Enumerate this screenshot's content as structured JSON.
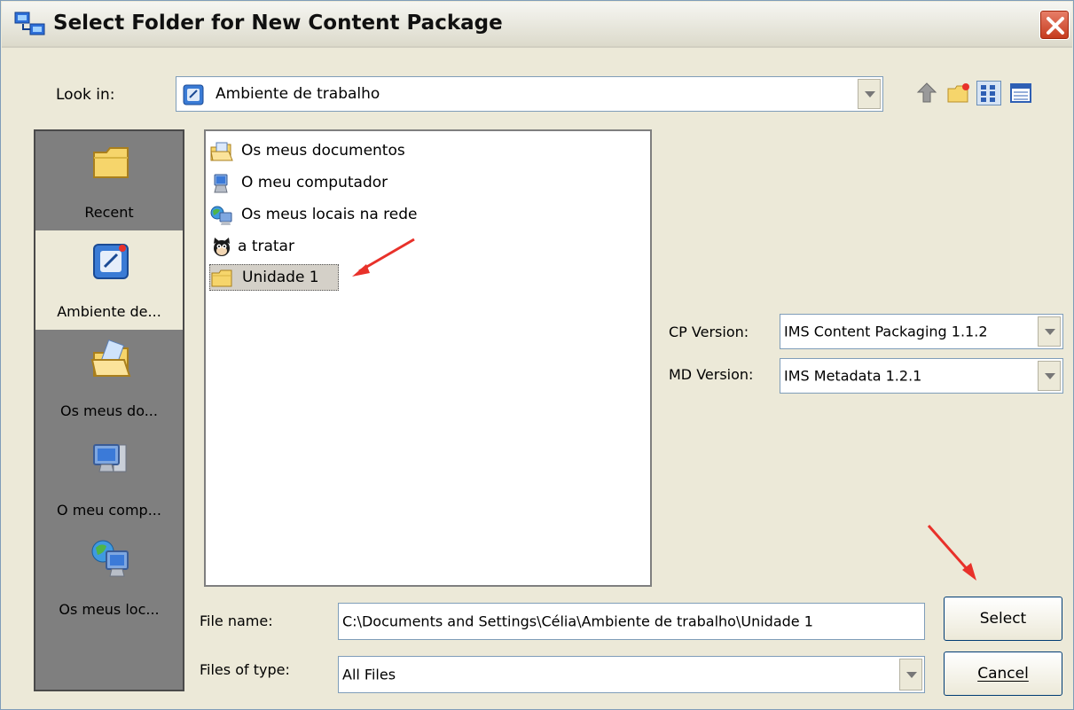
{
  "window": {
    "title": "Select Folder for New Content Package"
  },
  "look_in": {
    "label": "Look in:",
    "value": "Ambiente de trabalho"
  },
  "toolbar": {
    "icons": [
      "up-one-level-icon",
      "new-folder-icon",
      "list-view-icon",
      "details-view-icon"
    ]
  },
  "places": [
    {
      "label": "Recent",
      "icon": "recent-folder-icon"
    },
    {
      "label": "Ambiente de...",
      "icon": "desktop-icon",
      "selected": true
    },
    {
      "label": "Os meus do...",
      "icon": "my-documents-icon"
    },
    {
      "label": "O meu comp...",
      "icon": "my-computer-icon"
    },
    {
      "label": "Os meus loc...",
      "icon": "network-places-icon"
    }
  ],
  "files": [
    {
      "label": "Os meus documentos",
      "icon": "my-documents-icon"
    },
    {
      "label": "O meu computador",
      "icon": "my-computer-icon"
    },
    {
      "label": "Os meus locais na rede",
      "icon": "network-places-icon"
    },
    {
      "label": "a tratar",
      "icon": "cat-icon"
    },
    {
      "label": "Unidade 1",
      "icon": "folder-icon",
      "selected": true
    }
  ],
  "cp_version": {
    "label": "CP Version:",
    "value": "IMS Content Packaging 1.1.2"
  },
  "md_version": {
    "label": "MD Version:",
    "value": "IMS Metadata 1.2.1"
  },
  "file_name": {
    "label": "File name:",
    "value": "C:\\Documents and Settings\\Célia\\Ambiente de trabalho\\Unidade 1"
  },
  "files_of_type": {
    "label": "Files of type:",
    "value": "All Files"
  },
  "buttons": {
    "select": "Select",
    "cancel": "Cancel"
  },
  "colors": {
    "annotation_arrow": "#e8312a",
    "places_bar": "#7f7f7f",
    "dialog_bg": "#ece9d8"
  }
}
